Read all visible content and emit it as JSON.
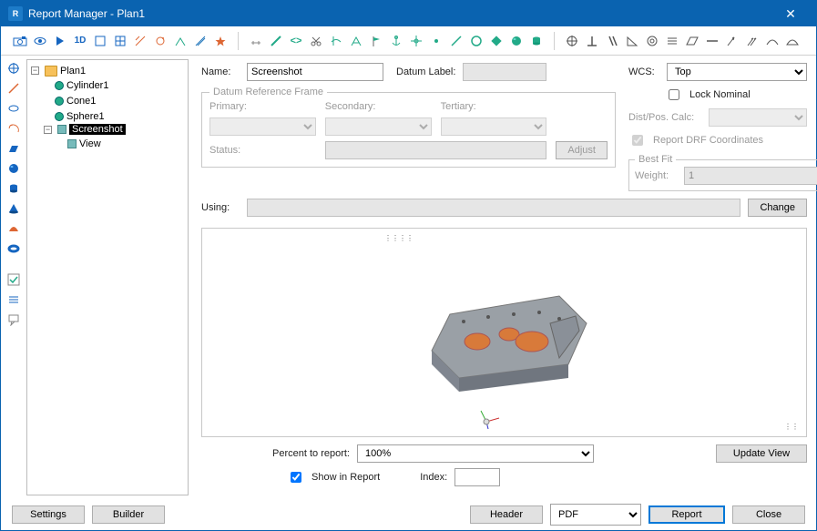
{
  "window": {
    "title": "Report Manager - Plan1",
    "app_badge": "R",
    "close_glyph": "✕"
  },
  "tree": {
    "root": "Plan1",
    "items": [
      {
        "label": "Cylinder1"
      },
      {
        "label": "Cone1"
      },
      {
        "label": "Sphere1"
      },
      {
        "label": "Screenshot",
        "selected": true
      },
      {
        "label": "View"
      }
    ]
  },
  "form": {
    "name_label": "Name:",
    "name_value": "Screenshot",
    "datum_label_label": "Datum Label:",
    "datum_label_value": "",
    "drf": {
      "legend": "Datum Reference Frame",
      "primary": "Primary:",
      "secondary": "Secondary:",
      "tertiary": "Tertiary:",
      "status": "Status:",
      "adjust": "Adjust"
    },
    "wcs_label": "WCS:",
    "wcs_value": "Top",
    "lock_nominal": "Lock Nominal",
    "distpos_label": "Dist/Pos. Calc:",
    "report_drf": "Report DRF Coordinates",
    "bestfit": {
      "legend": "Best Fit",
      "weight_label": "Weight:",
      "weight_value": "1"
    },
    "using_label": "Using:",
    "using_value": "",
    "change": "Change",
    "percent_label": "Percent to report:",
    "percent_value": "100%",
    "update_view": "Update View",
    "show_in_report": "Show in Report",
    "index_label": "Index:",
    "index_value": ""
  },
  "footer": {
    "settings": "Settings",
    "builder": "Builder",
    "header": "Header",
    "format": "PDF",
    "report": "Report",
    "close": "Close"
  }
}
